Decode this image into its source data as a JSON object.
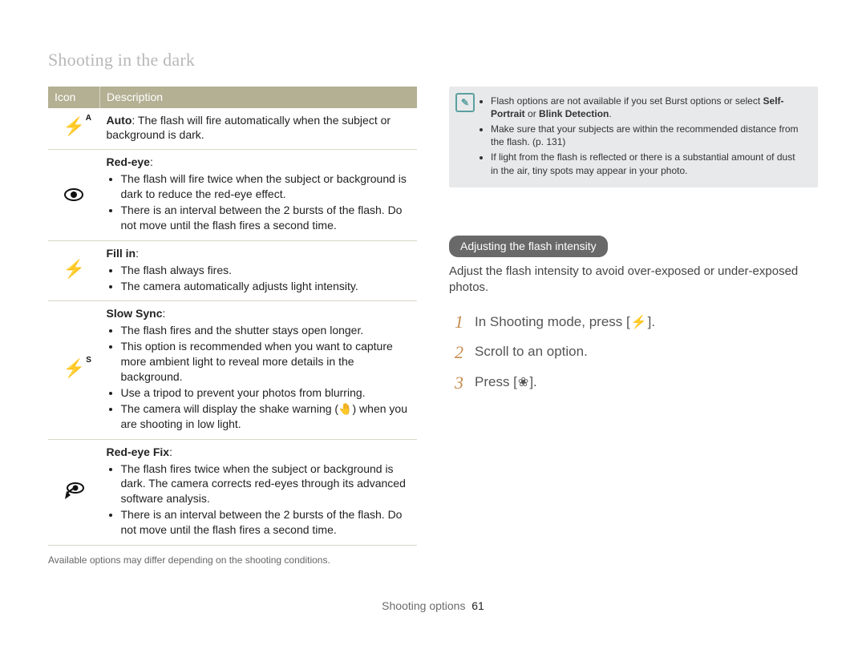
{
  "page": {
    "title": "Shooting in the dark",
    "footer_section": "Shooting options",
    "footer_page": "61"
  },
  "table": {
    "header_icon": "Icon",
    "header_desc": "Description",
    "rows": [
      {
        "icon_name": "flash-auto-icon",
        "icon_sup": "A",
        "title": "Auto",
        "after_title": ": The flash will fire automatically when the subject or background is dark."
      },
      {
        "icon_name": "red-eye-icon",
        "title": "Red-eye",
        "after_title": ":",
        "bullets": [
          "The flash will fire twice when the subject or background is dark to reduce the red-eye effect.",
          "There is an interval between the 2 bursts of the flash. Do not move until the flash fires a second time."
        ]
      },
      {
        "icon_name": "flash-fill-icon",
        "title": "Fill in",
        "after_title": ":",
        "bullets": [
          "The flash always fires.",
          "The camera automatically adjusts light intensity."
        ]
      },
      {
        "icon_name": "flash-slow-sync-icon",
        "icon_sup": "S",
        "title": "Slow Sync",
        "after_title": ":",
        "bullets": [
          "The flash fires and the shutter stays open longer.",
          "This option is recommended when you want to capture more ambient light to reveal more details in the background.",
          "Use a tripod to prevent your photos from blurring.",
          "The camera will display the shake warning (🤚) when you are shooting in low light."
        ]
      },
      {
        "icon_name": "red-eye-fix-icon",
        "title": "Red-eye Fix",
        "after_title": ":",
        "bullets": [
          "The flash fires twice when the subject or background is dark. The camera corrects red-eyes through its advanced software analysis.",
          "There is an interval between the 2 bursts of the flash. Do not move until the flash fires a second time."
        ]
      }
    ],
    "footnote": "Available options may differ depending on the shooting conditions."
  },
  "notes": {
    "items": [
      {
        "pre": "Flash options are not available if you set Burst options or select ",
        "bold1": "Self-Portrait",
        "mid": " or ",
        "bold2": "Blink Detection",
        "post": "."
      },
      {
        "text": "Make sure that your subjects are within the recommended distance from the flash. (p. 131)"
      },
      {
        "text": "If light from the flash is reflected or there is a substantial amount of dust in the air, tiny spots may appear in your photo."
      }
    ]
  },
  "section": {
    "pill": "Adjusting the flash intensity",
    "intro": "Adjust the flash intensity to avoid over-exposed or under-exposed photos.",
    "steps": [
      {
        "num": "1",
        "pre": "In Shooting mode, press [",
        "icon": "flash-icon",
        "glyph": "⚡",
        "post": "]."
      },
      {
        "num": "2",
        "text": "Scroll to an option."
      },
      {
        "num": "3",
        "pre": "Press [",
        "icon": "macro-icon",
        "glyph": "❀",
        "post": "]."
      }
    ]
  }
}
